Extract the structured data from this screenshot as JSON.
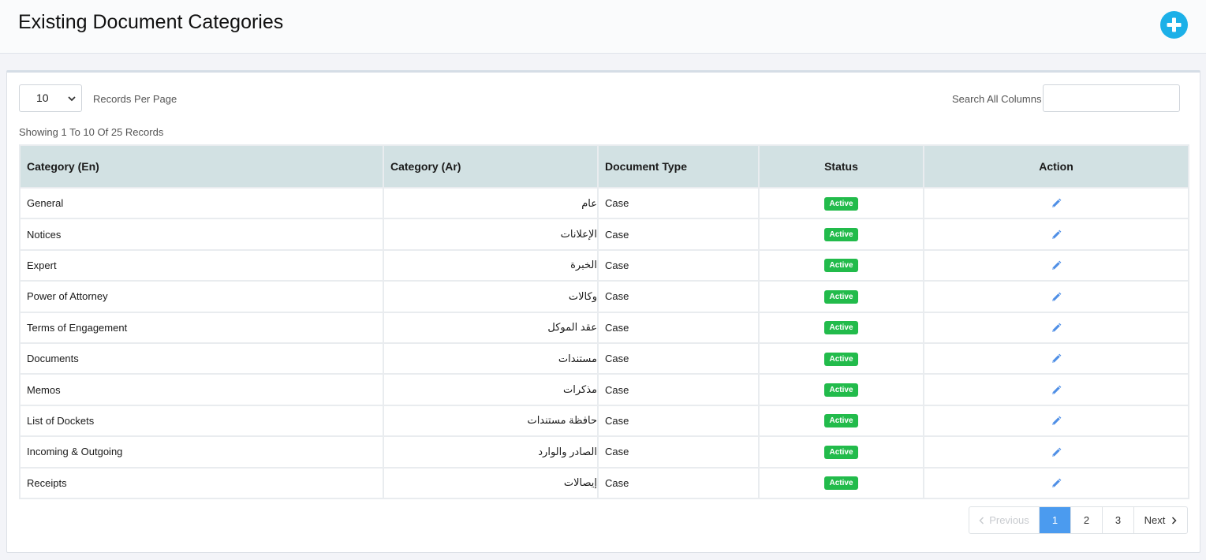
{
  "header": {
    "title": "Existing Document Categories",
    "add_icon": "plus-circle-icon",
    "accent": "#1cb0e8"
  },
  "controls": {
    "per_page_value": "10",
    "per_page_label": "Records Per Page",
    "search_label": "Search All Columns",
    "search_value": ""
  },
  "summary": "Showing 1 To 10 Of 25 Records",
  "table": {
    "columns": [
      "Category (En)",
      "Category (Ar)",
      "Document Type",
      "Status",
      "Action"
    ],
    "rows": [
      {
        "en": "General",
        "ar": "عام",
        "type": "Case",
        "status": "Active"
      },
      {
        "en": "Notices",
        "ar": "الإعلانات",
        "type": "Case",
        "status": "Active"
      },
      {
        "en": "Expert",
        "ar": "الخبرة",
        "type": "Case",
        "status": "Active"
      },
      {
        "en": "Power of Attorney",
        "ar": "وكالات",
        "type": "Case",
        "status": "Active"
      },
      {
        "en": "Terms of Engagement",
        "ar": "عقد الموكل",
        "type": "Case",
        "status": "Active"
      },
      {
        "en": "Documents",
        "ar": "مستندات",
        "type": "Case",
        "status": "Active"
      },
      {
        "en": "Memos",
        "ar": "مذكرات",
        "type": "Case",
        "status": "Active"
      },
      {
        "en": "List of Dockets",
        "ar": "حافظة مستندات",
        "type": "Case",
        "status": "Active"
      },
      {
        "en": "Incoming & Outgoing",
        "ar": "الصادر والوارد",
        "type": "Case",
        "status": "Active"
      },
      {
        "en": "Receipts",
        "ar": "إيصالات",
        "type": "Case",
        "status": "Active"
      }
    ],
    "action_icon": "pencil-icon",
    "status_color": "#22bb4b"
  },
  "pagination": {
    "previous": "Previous",
    "pages": [
      "1",
      "2",
      "3"
    ],
    "current": "1",
    "next": "Next"
  }
}
